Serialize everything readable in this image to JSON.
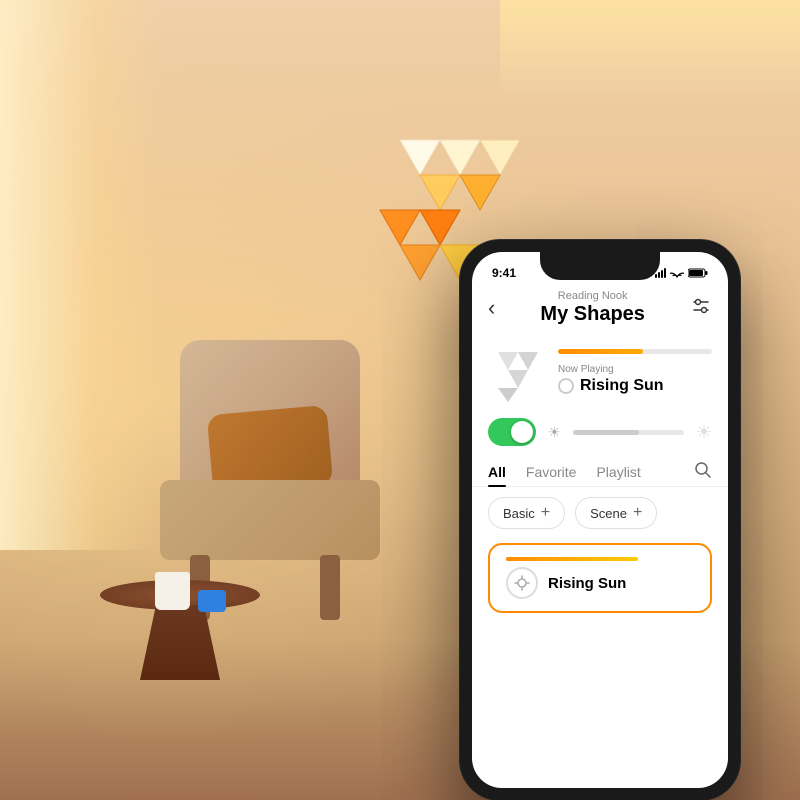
{
  "room": {
    "description": "Cozy reading nook with Nanoleaf panels"
  },
  "phone": {
    "status_bar": {
      "time": "9:41",
      "signal": "signal-icon",
      "wifi": "wifi-icon",
      "battery": "battery-icon"
    },
    "header": {
      "back_label": "‹",
      "subtitle": "Reading Nook",
      "title": "My Shapes",
      "settings_icon": "sliders-icon"
    },
    "now_playing": {
      "label": "Now Playing",
      "name": "Rising Sun",
      "progress": 55
    },
    "controls": {
      "toggle_on": true,
      "brightness_level": 60
    },
    "tabs": [
      {
        "id": "all",
        "label": "All",
        "active": true
      },
      {
        "id": "favorite",
        "label": "Favorite",
        "active": false
      },
      {
        "id": "playlist",
        "label": "Playlist",
        "active": false
      }
    ],
    "categories": [
      {
        "id": "basic",
        "label": "Basic"
      },
      {
        "id": "scene",
        "label": "Scene"
      }
    ],
    "scenes": [
      {
        "id": "rising-sun",
        "name": "Rising Sun",
        "icon": "sun-icon",
        "selected": true,
        "progress": 70
      }
    ]
  }
}
